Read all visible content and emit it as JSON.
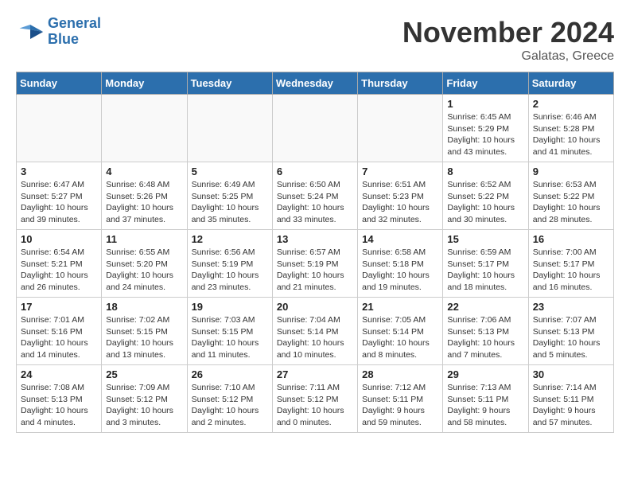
{
  "header": {
    "logo_line1": "General",
    "logo_line2": "Blue",
    "month": "November 2024",
    "location": "Galatas, Greece"
  },
  "days_of_week": [
    "Sunday",
    "Monday",
    "Tuesday",
    "Wednesday",
    "Thursday",
    "Friday",
    "Saturday"
  ],
  "weeks": [
    [
      {
        "day": "",
        "detail": ""
      },
      {
        "day": "",
        "detail": ""
      },
      {
        "day": "",
        "detail": ""
      },
      {
        "day": "",
        "detail": ""
      },
      {
        "day": "",
        "detail": ""
      },
      {
        "day": "1",
        "detail": "Sunrise: 6:45 AM\nSunset: 5:29 PM\nDaylight: 10 hours\nand 43 minutes."
      },
      {
        "day": "2",
        "detail": "Sunrise: 6:46 AM\nSunset: 5:28 PM\nDaylight: 10 hours\nand 41 minutes."
      }
    ],
    [
      {
        "day": "3",
        "detail": "Sunrise: 6:47 AM\nSunset: 5:27 PM\nDaylight: 10 hours\nand 39 minutes."
      },
      {
        "day": "4",
        "detail": "Sunrise: 6:48 AM\nSunset: 5:26 PM\nDaylight: 10 hours\nand 37 minutes."
      },
      {
        "day": "5",
        "detail": "Sunrise: 6:49 AM\nSunset: 5:25 PM\nDaylight: 10 hours\nand 35 minutes."
      },
      {
        "day": "6",
        "detail": "Sunrise: 6:50 AM\nSunset: 5:24 PM\nDaylight: 10 hours\nand 33 minutes."
      },
      {
        "day": "7",
        "detail": "Sunrise: 6:51 AM\nSunset: 5:23 PM\nDaylight: 10 hours\nand 32 minutes."
      },
      {
        "day": "8",
        "detail": "Sunrise: 6:52 AM\nSunset: 5:22 PM\nDaylight: 10 hours\nand 30 minutes."
      },
      {
        "day": "9",
        "detail": "Sunrise: 6:53 AM\nSunset: 5:22 PM\nDaylight: 10 hours\nand 28 minutes."
      }
    ],
    [
      {
        "day": "10",
        "detail": "Sunrise: 6:54 AM\nSunset: 5:21 PM\nDaylight: 10 hours\nand 26 minutes."
      },
      {
        "day": "11",
        "detail": "Sunrise: 6:55 AM\nSunset: 5:20 PM\nDaylight: 10 hours\nand 24 minutes."
      },
      {
        "day": "12",
        "detail": "Sunrise: 6:56 AM\nSunset: 5:19 PM\nDaylight: 10 hours\nand 23 minutes."
      },
      {
        "day": "13",
        "detail": "Sunrise: 6:57 AM\nSunset: 5:19 PM\nDaylight: 10 hours\nand 21 minutes."
      },
      {
        "day": "14",
        "detail": "Sunrise: 6:58 AM\nSunset: 5:18 PM\nDaylight: 10 hours\nand 19 minutes."
      },
      {
        "day": "15",
        "detail": "Sunrise: 6:59 AM\nSunset: 5:17 PM\nDaylight: 10 hours\nand 18 minutes."
      },
      {
        "day": "16",
        "detail": "Sunrise: 7:00 AM\nSunset: 5:17 PM\nDaylight: 10 hours\nand 16 minutes."
      }
    ],
    [
      {
        "day": "17",
        "detail": "Sunrise: 7:01 AM\nSunset: 5:16 PM\nDaylight: 10 hours\nand 14 minutes."
      },
      {
        "day": "18",
        "detail": "Sunrise: 7:02 AM\nSunset: 5:15 PM\nDaylight: 10 hours\nand 13 minutes."
      },
      {
        "day": "19",
        "detail": "Sunrise: 7:03 AM\nSunset: 5:15 PM\nDaylight: 10 hours\nand 11 minutes."
      },
      {
        "day": "20",
        "detail": "Sunrise: 7:04 AM\nSunset: 5:14 PM\nDaylight: 10 hours\nand 10 minutes."
      },
      {
        "day": "21",
        "detail": "Sunrise: 7:05 AM\nSunset: 5:14 PM\nDaylight: 10 hours\nand 8 minutes."
      },
      {
        "day": "22",
        "detail": "Sunrise: 7:06 AM\nSunset: 5:13 PM\nDaylight: 10 hours\nand 7 minutes."
      },
      {
        "day": "23",
        "detail": "Sunrise: 7:07 AM\nSunset: 5:13 PM\nDaylight: 10 hours\nand 5 minutes."
      }
    ],
    [
      {
        "day": "24",
        "detail": "Sunrise: 7:08 AM\nSunset: 5:13 PM\nDaylight: 10 hours\nand 4 minutes."
      },
      {
        "day": "25",
        "detail": "Sunrise: 7:09 AM\nSunset: 5:12 PM\nDaylight: 10 hours\nand 3 minutes."
      },
      {
        "day": "26",
        "detail": "Sunrise: 7:10 AM\nSunset: 5:12 PM\nDaylight: 10 hours\nand 2 minutes."
      },
      {
        "day": "27",
        "detail": "Sunrise: 7:11 AM\nSunset: 5:12 PM\nDaylight: 10 hours\nand 0 minutes."
      },
      {
        "day": "28",
        "detail": "Sunrise: 7:12 AM\nSunset: 5:11 PM\nDaylight: 9 hours\nand 59 minutes."
      },
      {
        "day": "29",
        "detail": "Sunrise: 7:13 AM\nSunset: 5:11 PM\nDaylight: 9 hours\nand 58 minutes."
      },
      {
        "day": "30",
        "detail": "Sunrise: 7:14 AM\nSunset: 5:11 PM\nDaylight: 9 hours\nand 57 minutes."
      }
    ]
  ]
}
